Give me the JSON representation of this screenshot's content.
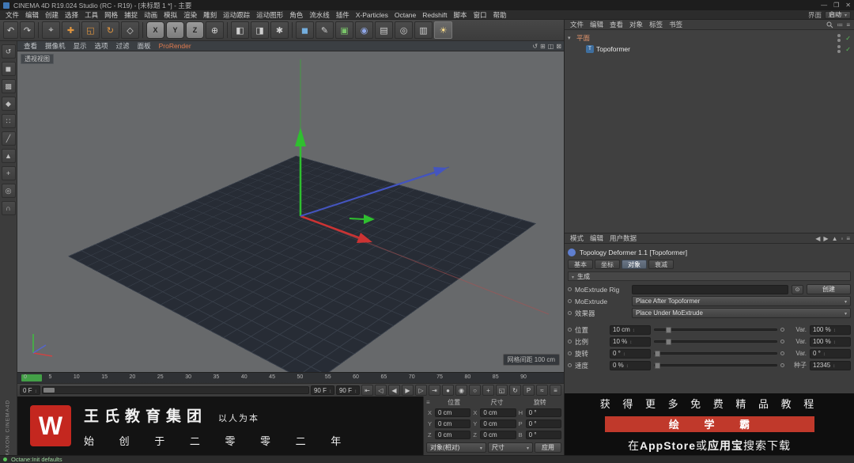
{
  "titlebar": {
    "title": "CINEMA 4D R19.024 Studio (RC - R19) - [未标题 1 *] - 主要"
  },
  "window_controls": {
    "minimize": "—",
    "maximize": "❐",
    "close": "✕"
  },
  "menubar": {
    "items": [
      "文件",
      "编辑",
      "创建",
      "选择",
      "工具",
      "网格",
      "捕捉",
      "动画",
      "模拟",
      "渲染",
      "雕刻",
      "运动跟踪",
      "运动图形",
      "角色",
      "流水线",
      "插件",
      "X-Particles",
      "Octane",
      "Redshift",
      "脚本",
      "窗口",
      "帮助"
    ],
    "interface_label": "界面",
    "layout_preset": "启动"
  },
  "toolbar": {
    "buttons": [
      {
        "name": "undo-icon",
        "glyph": "↶"
      },
      {
        "name": "redo-icon",
        "glyph": "↷"
      },
      {
        "name": "live-selection-icon",
        "glyph": "⌖"
      },
      {
        "name": "move-icon",
        "glyph": "✚"
      },
      {
        "name": "scale-icon",
        "glyph": "◱"
      },
      {
        "name": "rotate-icon",
        "glyph": "↻"
      },
      {
        "name": "last-tool-icon",
        "glyph": "◇"
      },
      {
        "name": "lock-x-button",
        "glyph": "X"
      },
      {
        "name": "lock-y-button",
        "glyph": "Y"
      },
      {
        "name": "lock-z-button",
        "glyph": "Z"
      },
      {
        "name": "coordinate-system-icon",
        "glyph": "⊕"
      },
      {
        "name": "render-view-icon",
        "glyph": "◧"
      },
      {
        "name": "render-region-icon",
        "glyph": "◨"
      },
      {
        "name": "render-settings-icon",
        "glyph": "✱"
      },
      {
        "name": "add-primitive-icon",
        "glyph": "◼"
      },
      {
        "name": "add-spline-icon",
        "glyph": "✎"
      },
      {
        "name": "add-generator-icon",
        "glyph": "▣"
      },
      {
        "name": "add-deformer-icon",
        "glyph": "◉"
      },
      {
        "name": "add-environment-icon",
        "glyph": "▤"
      },
      {
        "name": "add-camera-icon",
        "glyph": "◎"
      },
      {
        "name": "display-mode-icon",
        "glyph": "▥"
      },
      {
        "name": "light-icon",
        "glyph": "☀"
      }
    ]
  },
  "sidebar": {
    "tools": [
      {
        "name": "make-editable-icon",
        "glyph": "↺"
      },
      {
        "name": "model-mode-icon",
        "glyph": "◼"
      },
      {
        "name": "texture-mode-icon",
        "glyph": "▩"
      },
      {
        "name": "workplane-mode-icon",
        "glyph": "◆"
      },
      {
        "name": "points-mode-icon",
        "glyph": "∷"
      },
      {
        "name": "edges-mode-icon",
        "glyph": "╱"
      },
      {
        "name": "polygons-mode-icon",
        "glyph": "▲"
      },
      {
        "name": "enable-axis-icon",
        "glyph": "+"
      },
      {
        "name": "viewport-solo-icon",
        "glyph": "◎"
      },
      {
        "name": "snap-icon",
        "glyph": "∩"
      }
    ]
  },
  "viewport": {
    "label": "透视视图",
    "menu": [
      "查看",
      "摄像机",
      "显示",
      "选项",
      "过滤",
      "面板"
    ],
    "prorender_menu": "ProRender",
    "grid_spacing": "网格间距 100 cm"
  },
  "timeline": {
    "ticks": [
      "0",
      "5",
      "10",
      "15",
      "20",
      "25",
      "30",
      "35",
      "40",
      "45",
      "50",
      "55",
      "60",
      "65",
      "70",
      "75",
      "80",
      "85",
      "90"
    ]
  },
  "transport": {
    "current_frame": "0 F",
    "range_end": "90 F",
    "end_frame": "90 F",
    "buttons": [
      {
        "name": "goto-start-button",
        "glyph": "⇤"
      },
      {
        "name": "prev-key-button",
        "glyph": "◁"
      },
      {
        "name": "prev-frame-button",
        "glyph": "◀"
      },
      {
        "name": "play-button",
        "glyph": "▶"
      },
      {
        "name": "next-frame-button",
        "glyph": "▷"
      },
      {
        "name": "goto-end-button",
        "glyph": "⇥"
      },
      {
        "name": "record-button",
        "glyph": "●"
      },
      {
        "name": "autokey-button",
        "glyph": "◉"
      },
      {
        "name": "keyframe-selection-button",
        "glyph": "○"
      },
      {
        "name": "record-position-button",
        "glyph": "+"
      },
      {
        "name": "record-scale-button",
        "glyph": "◱"
      },
      {
        "name": "record-rotation-button",
        "glyph": "↻"
      },
      {
        "name": "record-parameter-button",
        "glyph": "P"
      },
      {
        "name": "record-pla-button",
        "glyph": "≈"
      }
    ]
  },
  "coordinates": {
    "position_title": "位置",
    "size_title": "尺寸",
    "rotation_title": "旋转",
    "rows": [
      {
        "p_axis": "X",
        "p_val": "0 cm",
        "s_axis": "X",
        "s_val": "0 cm",
        "r_axis": "H",
        "r_val": "0 °"
      },
      {
        "p_axis": "Y",
        "p_val": "0 cm",
        "s_axis": "Y",
        "s_val": "0 cm",
        "r_axis": "P",
        "r_val": "0 °"
      },
      {
        "p_axis": "Z",
        "p_val": "0 cm",
        "s_axis": "Z",
        "s_val": "0 cm",
        "r_axis": "B",
        "r_val": "0 °"
      }
    ],
    "mode": "对象(相对)",
    "size_mode": "尺寸",
    "apply": "应用"
  },
  "object_manager": {
    "menu": [
      "文件",
      "编辑",
      "查看",
      "对象",
      "标签",
      "书签"
    ],
    "items": [
      {
        "label": "平面"
      },
      {
        "label": "Topoformer"
      }
    ]
  },
  "attribute_manager": {
    "menu": [
      "模式",
      "编辑",
      "用户数据"
    ],
    "title": "Topology Deformer 1.1 [Topoformer]",
    "tabs": [
      "基本",
      "坐标",
      "对象",
      "衰减"
    ],
    "section": "生成",
    "rig_label": "MoExtrude Rig",
    "create_button": "创建",
    "moextrude_label": "MoExtrude",
    "moextrude_value": "Place After Topoformer",
    "effector_label": "效果器",
    "effector_value": "Place Under MoExtrude",
    "params": [
      {
        "label": "位置",
        "value": "10 cm",
        "var_label": "Var.",
        "var_value": "100 %"
      },
      {
        "label": "比例",
        "value": "10 %",
        "var_label": "Var.",
        "var_value": "100 %"
      },
      {
        "label": "旋转",
        "value": "0 °",
        "var_label": "Var.",
        "var_value": "0 °"
      },
      {
        "label": "速度",
        "value": "0 %",
        "var_label": "种子",
        "var_value": "12345"
      }
    ]
  },
  "ads": {
    "left": {
      "logo": "W",
      "brand": "王氏教育集团",
      "slogan": "以人为本",
      "line2": "始 创 于 二 零 零 二 年"
    },
    "right": {
      "line1": "获 得 更 多 免 费 精 品 教 程",
      "highlight": "绘 学 霸",
      "line3_pre": "在",
      "line3_appstore": "AppStore",
      "line3_or": "或",
      "line3_yyb": "应用宝",
      "line3_post": "搜索下载"
    }
  },
  "statusbar": {
    "text": "Octane:Init defaults"
  },
  "branding": {
    "vertical": "MAXON CINEMA4D"
  }
}
